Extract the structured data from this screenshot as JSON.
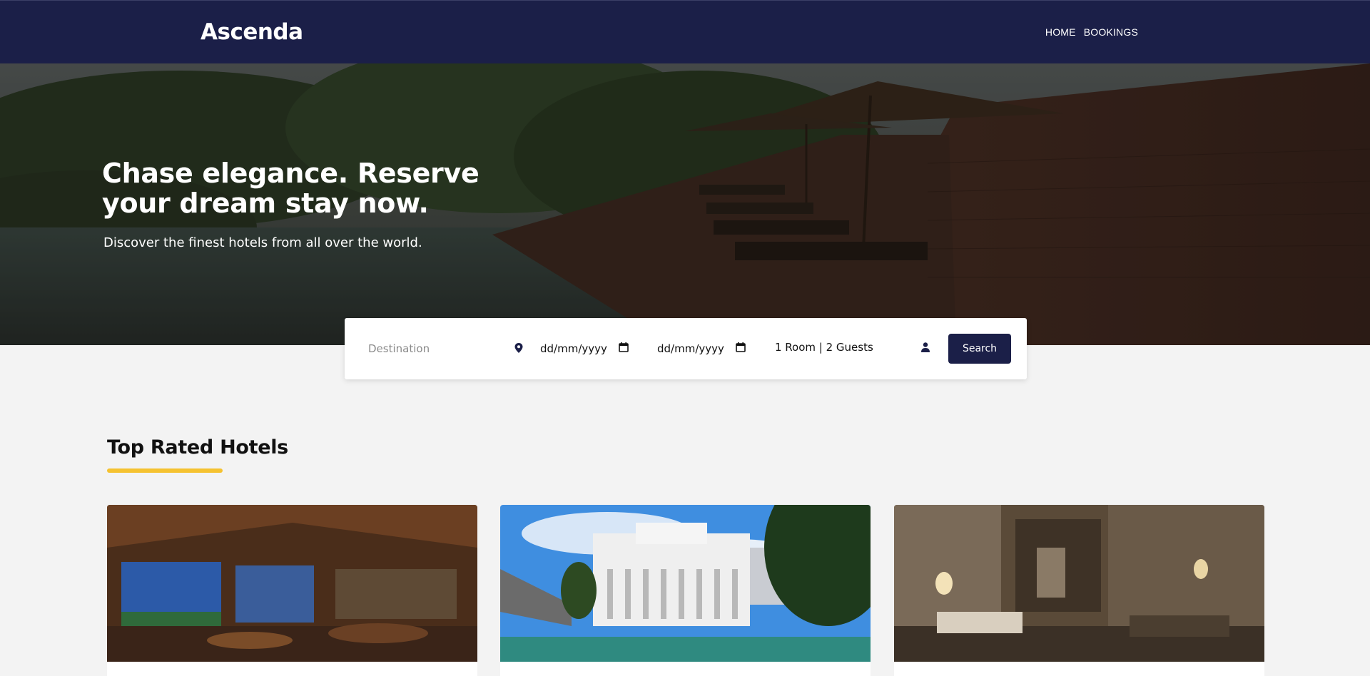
{
  "navbar": {
    "logo": "Ascenda",
    "links": [
      "HOME",
      "BOOKINGS"
    ],
    "bg_color": "#1b1f48"
  },
  "hero": {
    "title": "Chase elegance. Reserve your dream stay now.",
    "subtitle": "Discover the finest hotels from all over the world."
  },
  "search": {
    "destination_placeholder": "Destination",
    "destination_icon": "map-pin-icon",
    "checkin_placeholder": "dd/mm/yyyy",
    "checkout_placeholder": "dd/mm/yyyy",
    "calendar_icon": "calendar-icon",
    "guests": "1 Room | 2 Guests",
    "guests_icon": "user-icon",
    "button_label": "Search"
  },
  "top_rated": {
    "title": "Top Rated Hotels",
    "accent_color": "#f5c230",
    "cards": [
      {
        "image": "hotel-restaurant-photo"
      },
      {
        "image": "hotel-colonial-building-photo"
      },
      {
        "image": "hotel-lobby-photo"
      }
    ]
  }
}
